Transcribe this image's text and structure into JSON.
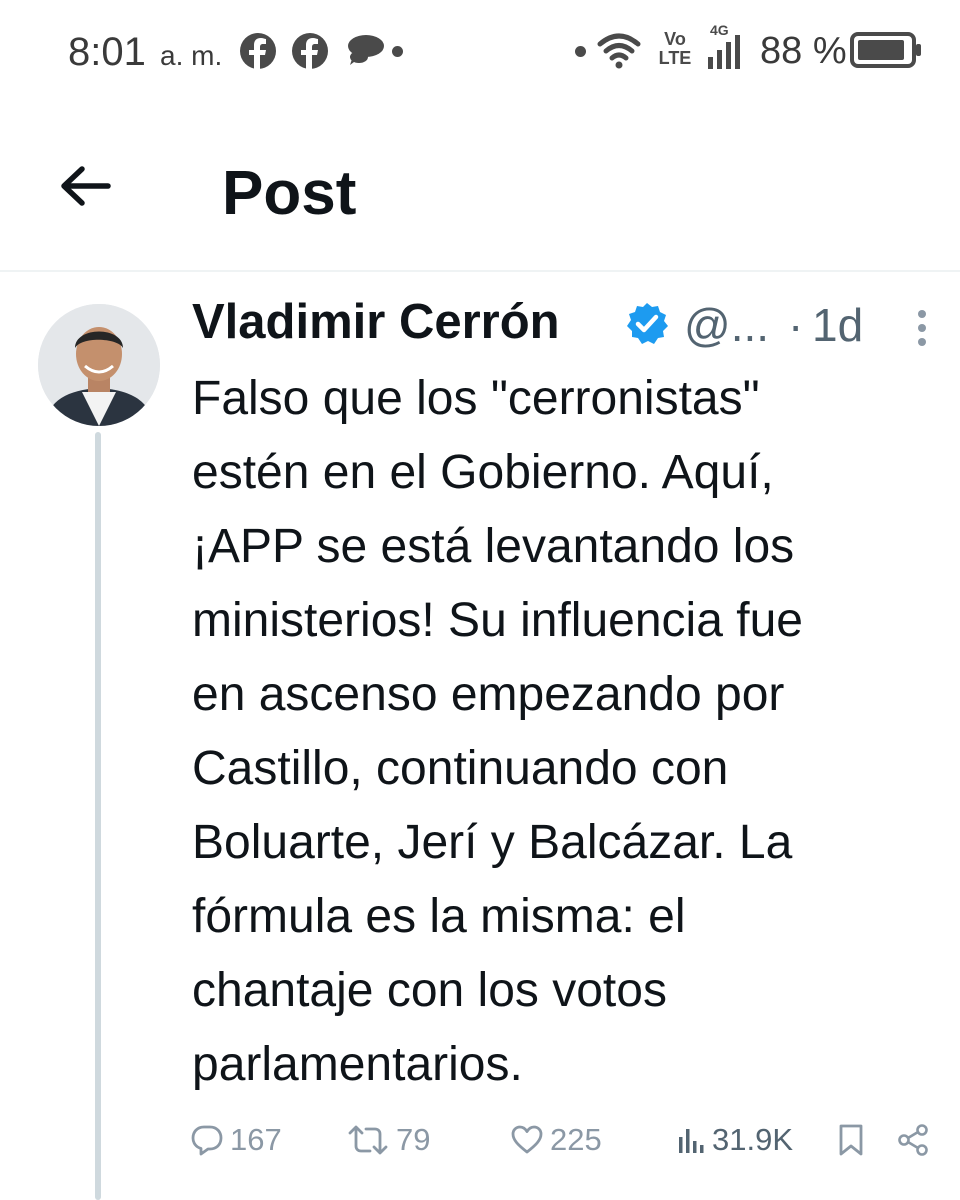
{
  "status_bar": {
    "time": "8:01",
    "ampm": "a. m.",
    "network_volte": "Vo\nLTE",
    "network_type": "4G",
    "battery_percent": "88 %",
    "icons": [
      "facebook-icon",
      "facebook-icon",
      "chat-bubbles-icon",
      "notification-dot",
      "wifi-icon",
      "signal-icon",
      "battery-icon"
    ]
  },
  "header": {
    "title": "Post"
  },
  "tweet": {
    "author_name": "Vladimir Cerrón",
    "handle": "@...",
    "separator": "·",
    "time_ago": "1d",
    "text_lines": [
      "Falso que los \"cerronistas\"",
      "estén en el Gobierno. Aquí,",
      "¡APP se está levantando los",
      "ministerios! Su influencia fue",
      "en ascenso empezando por",
      "Castillo, continuando con",
      "Boluarte, Jerí y Balcázar. La",
      "fórmula es la misma: el",
      "chantaje con los votos",
      "parlamentarios."
    ],
    "metrics": {
      "replies": "167",
      "reposts": "79",
      "likes": "225",
      "views": "31.9K"
    }
  },
  "colors": {
    "text_primary": "#0f1419",
    "text_secondary": "#536471",
    "action_gray": "#8b98a5",
    "verified_blue": "#1d9bf0",
    "divider": "#eff3f4",
    "thread_line": "#cfd9de"
  }
}
